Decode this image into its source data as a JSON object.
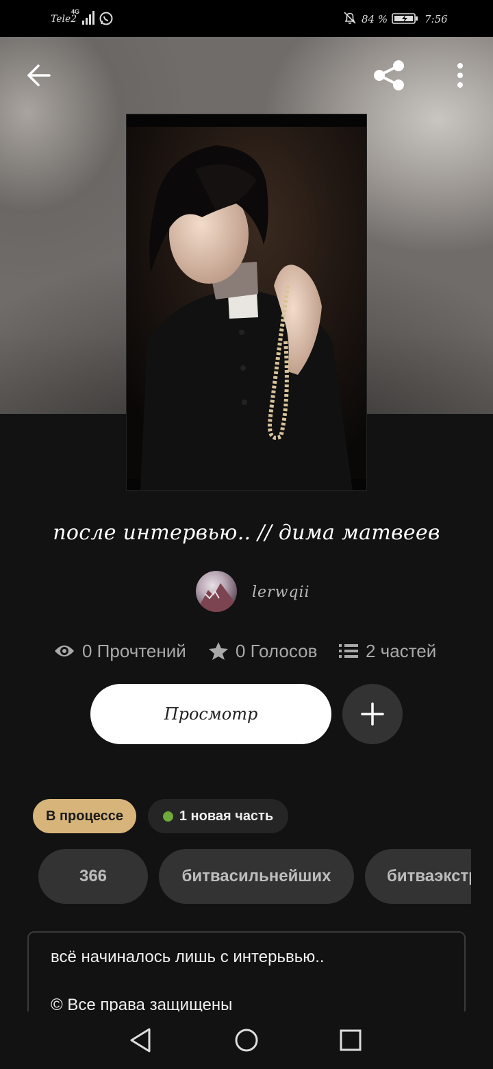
{
  "status_bar": {
    "carrier": "Tele2",
    "network": "4G",
    "battery": "84 %",
    "time": "7:56"
  },
  "story": {
    "title": "после интервью.. // дима матвеев",
    "author": "lerwqii",
    "stats": {
      "reads": "0 Прочтений",
      "votes": "0 Голосов",
      "parts": "2 частей"
    },
    "read_button": "Просмотр",
    "status_badge": "В процессе",
    "new_part_badge": "1 новая часть",
    "tags": [
      "366",
      "битвасильнейших",
      "битваэкстрасенсов"
    ],
    "description": {
      "line1": "всё начиналось лишь с интерьвью..",
      "line2": "© Все права защищены"
    }
  },
  "colors": {
    "background": "#121212",
    "status_badge_bg": "#d7b57a",
    "new_dot": "#6eab3a",
    "chip_bg": "#333333"
  },
  "icons": [
    "back-arrow-icon",
    "share-icon",
    "more-vertical-icon",
    "eye-icon",
    "star-icon",
    "list-icon",
    "plus-icon",
    "nav-back-icon",
    "nav-home-icon",
    "nav-recents-icon"
  ]
}
